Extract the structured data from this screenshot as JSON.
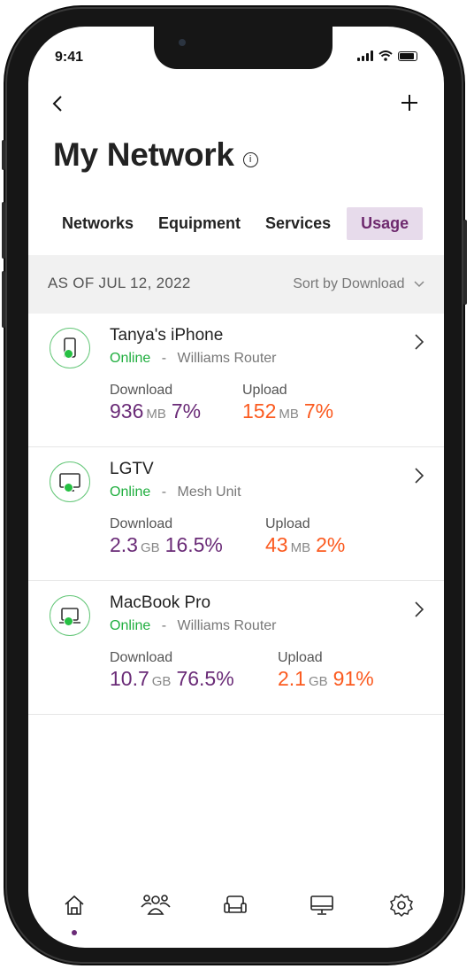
{
  "status_bar": {
    "time": "9:41"
  },
  "header": {
    "title": "My Network"
  },
  "tabs": [
    {
      "label": "Networks",
      "active": false
    },
    {
      "label": "Equipment",
      "active": false
    },
    {
      "label": "Services",
      "active": false
    },
    {
      "label": "Usage",
      "active": true
    }
  ],
  "usage": {
    "as_of": "AS OF JUL 12, 2022",
    "sort_label": "Sort by Download",
    "devices": [
      {
        "name": "Tanya's iPhone",
        "status": "Online",
        "separator": "-",
        "connection": "Williams Router",
        "download_label": "Download",
        "download_value": "936",
        "download_unit": "MB",
        "download_pct": "7%",
        "upload_label": "Upload",
        "upload_value": "152",
        "upload_unit": "MB",
        "upload_pct": "7%",
        "icon": "phone-icon"
      },
      {
        "name": "LGTV",
        "status": "Online",
        "separator": "-",
        "connection": "Mesh Unit",
        "download_label": "Download",
        "download_value": "2.3",
        "download_unit": "GB",
        "download_pct": "16.5%",
        "upload_label": "Upload",
        "upload_value": "43",
        "upload_unit": "MB",
        "upload_pct": "2%",
        "icon": "tv-icon"
      },
      {
        "name": "MacBook Pro",
        "status": "Online",
        "separator": "-",
        "connection": "Williams Router",
        "download_label": "Download",
        "download_value": "10.7",
        "download_unit": "GB",
        "download_pct": "76.5%",
        "upload_label": "Upload",
        "upload_value": "2.1",
        "upload_unit": "GB",
        "upload_pct": "91%",
        "icon": "laptop-icon"
      }
    ]
  },
  "bottom_nav": [
    "home-icon",
    "people-icon",
    "couch-icon",
    "monitor-icon",
    "settings-icon"
  ],
  "colors": {
    "accent": "#6a2b77",
    "upload": "#fb5a1f",
    "online": "#1fae3e",
    "tab_active_bg": "#e7dbeb"
  }
}
